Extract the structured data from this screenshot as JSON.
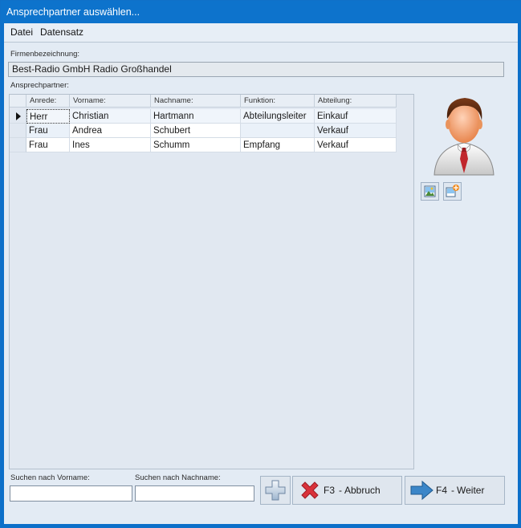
{
  "window": {
    "title": "Ansprechpartner auswählen..."
  },
  "menu": {
    "items": [
      "Datei",
      "Datensatz"
    ]
  },
  "firm": {
    "label": "Firmenbezeichnung:",
    "value": "Best-Radio GmbH Radio Großhandel"
  },
  "contacts": {
    "label": "Ansprechpartner:",
    "columns": [
      "Anrede:",
      "Vorname:",
      "Nachname:",
      "Funktion:",
      "Abteilung:"
    ],
    "rows": [
      {
        "anrede": "Herr",
        "vorname": "Christian",
        "nachname": "Hartmann",
        "funktion": "Abteilungsleiter",
        "abteilung": "Einkauf"
      },
      {
        "anrede": "Frau",
        "vorname": "Andrea",
        "nachname": "Schubert",
        "funktion": "",
        "abteilung": "Verkauf"
      },
      {
        "anrede": "Frau",
        "vorname": "Ines",
        "nachname": "Schumm",
        "funktion": "Empfang",
        "abteilung": "Verkauf"
      }
    ]
  },
  "search": {
    "vorname_label": "Suchen nach Vorname:",
    "nachname_label": "Suchen nach Nachname:",
    "vorname_value": "",
    "nachname_value": ""
  },
  "buttons": {
    "cancel": {
      "key": "F3",
      "label": "Abbruch"
    },
    "next": {
      "key": "F4",
      "label": "Weiter"
    }
  },
  "icons": {
    "avatar": "person-avatar-icon",
    "picture": "picture-icon",
    "edit_picture": "edit-picture-icon",
    "add": "plus-icon",
    "cancel": "red-x-icon",
    "next": "blue-arrow-right-icon"
  },
  "colors": {
    "titlebar": "#0d73cc",
    "cancel_icon": "#d9323a",
    "next_icon": "#3b86c8"
  }
}
